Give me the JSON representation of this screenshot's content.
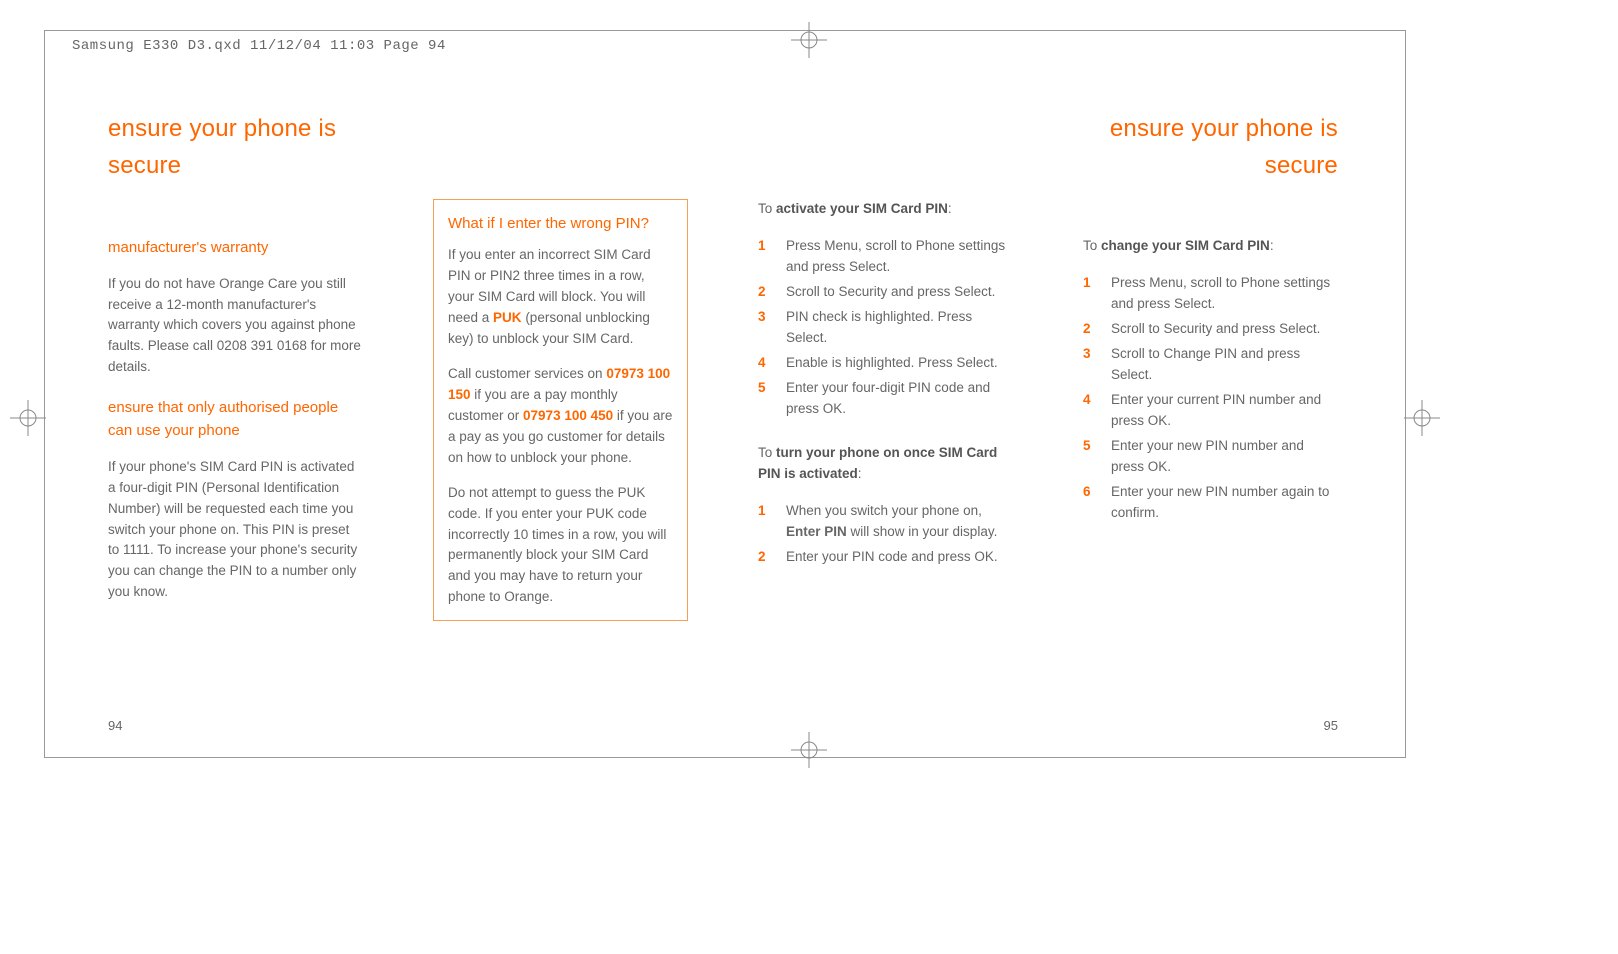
{
  "slug": "Samsung E330 D3.qxd  11/12/04  11:03  Page 94",
  "header_left": "ensure your phone is secure",
  "header_right": "ensure your phone is secure",
  "col1": {
    "h_warranty": "manufacturer's warranty",
    "p_warranty": "If you do not have Orange Care you still receive a 12-month manufacturer's warranty which covers you against phone faults. Please call 0208 391 0168 for more details.",
    "h_ensure": "ensure that only authorised people can use your phone",
    "p_ensure": "If your phone's SIM Card PIN is activated a four-digit PIN (Personal Identification Number) will be requested each time you switch your phone on. This PIN is preset to 1111. To increase your phone's security you can change the PIN to a number only you know."
  },
  "col2": {
    "h_box": "What if I enter the wrong PIN?",
    "p1a": "If you enter an incorrect SIM Card PIN or PIN2 three times in a row, your SIM Card will block. You will need a ",
    "puk": "PUK",
    "p1b": " (personal unblocking key) to unblock your SIM Card.",
    "p2a": "Call customer services on ",
    "num1": "07973 100 150",
    "p2b": " if you are a pay monthly customer or ",
    "num2": "07973 100 450",
    "p2c": " if you are a pay as you go customer for details on how to unblock your phone.",
    "p3": "Do not attempt to guess the PUK code. If you enter your PUK code incorrectly 10 times in a row, you will permanently block your SIM Card and you may have to return your phone to Orange."
  },
  "col3": {
    "lead1_pre": "To ",
    "lead1_bold": "activate your SIM Card PIN",
    "lead1_post": ":",
    "steps1": [
      "Press Menu, scroll to Phone settings and press Select.",
      "Scroll to Security and press Select.",
      "PIN check is highlighted. Press Select.",
      "Enable is highlighted. Press Select.",
      "Enter your four-digit PIN code and press OK."
    ],
    "lead2_pre": "To ",
    "lead2_bold": "turn your phone on once SIM Card PIN is activated",
    "lead2_post": ":",
    "step2_1a": "When you switch your phone on, ",
    "step2_1b": "Enter PIN",
    "step2_1c": " will show in your display.",
    "step2_2": "Enter your PIN code and press OK."
  },
  "col4": {
    "lead_pre": "To ",
    "lead_bold": "change your SIM Card PIN",
    "lead_post": ":",
    "steps": [
      "Press Menu, scroll to Phone settings and press Select.",
      "Scroll to Security and press Select.",
      "Scroll to Change PIN and press Select.",
      "Enter your current PIN number and press OK.",
      "Enter your new PIN number and press OK.",
      "Enter your new PIN number again to confirm."
    ]
  },
  "pagenum_left": "94",
  "pagenum_right": "95"
}
